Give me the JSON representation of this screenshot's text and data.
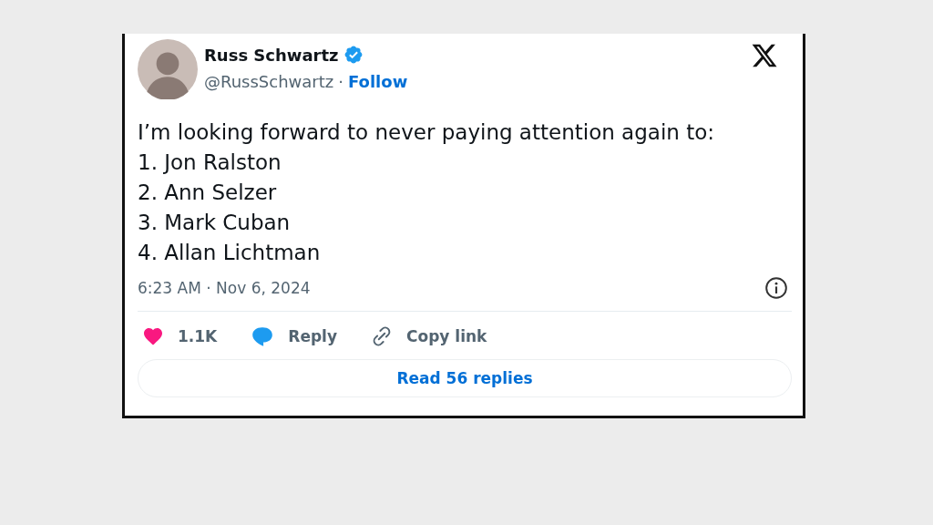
{
  "author": {
    "name": "Russ Schwartz",
    "verified": true,
    "handle": "@RussSchwartz",
    "separator": "·",
    "follow": "Follow"
  },
  "tweet": {
    "intro": "I’m looking forward to never paying attention again to:",
    "list": [
      "1. Jon Ralston",
      "2. Ann Selzer",
      "3. Mark Cuban",
      "4. Allan Lichtman"
    ]
  },
  "timestamp": "6:23 AM · Nov 6, 2024",
  "actions": [
    {
      "kind": "like",
      "label": "1.1K"
    },
    {
      "kind": "reply",
      "label": "Reply"
    },
    {
      "kind": "copy",
      "label": "Copy link"
    }
  ],
  "read_replies": "Read 56 replies"
}
